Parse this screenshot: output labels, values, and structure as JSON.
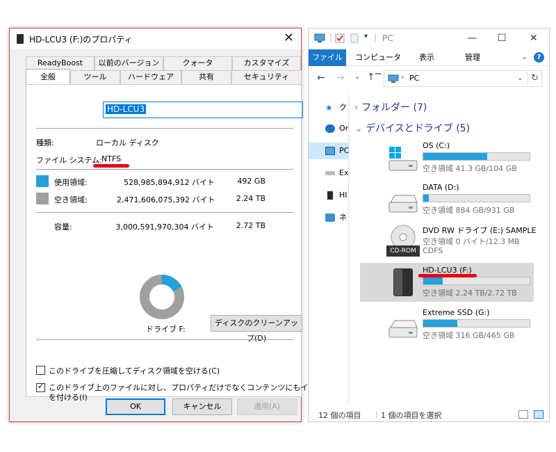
{
  "dialog": {
    "title": "HD-LCU3 (F:)のプロパティ",
    "tabs_row1": [
      "ReadyBoost",
      "以前のバージョン",
      "クォータ",
      "カスタマイズ"
    ],
    "tabs_row2": [
      "全般",
      "ツール",
      "ハードウェア",
      "共有",
      "セキュリティ"
    ],
    "volume_name": "HD-LCU3",
    "type_label": "種類:",
    "type_value": "ローカル ディスク",
    "fs_label": "ファイル システム:",
    "fs_value": "NTFS",
    "used_label": "使用領域:",
    "used_bytes": "528,985,894,912 バイト",
    "used_size": "492 GB",
    "free_label": "空き領域:",
    "free_bytes": "2,471,606,075,392 バイト",
    "free_size": "2.24 TB",
    "capacity_label": "容量:",
    "capacity_bytes": "3,000,591,970,304 バイト",
    "capacity_size": "2.72 TB",
    "drive_label": "ドライブ F:",
    "cleanup_button": "ディスクのクリーンアップ(D)",
    "compress_option": "このドライブを圧縮してディスク領域を空ける(C)",
    "compress_checked": false,
    "index_option_line1": "このドライブ上のファイルに対し、プロパティだけでなくコンテンツにもインデックス",
    "index_option_line2": "を付ける(I)",
    "index_checked": true,
    "ok": "OK",
    "cancel": "キャンセル",
    "apply": "適用(A)",
    "used_fraction": 0.176,
    "colors": {
      "used": "#26a0da",
      "free": "#a0a0a0",
      "accent": "#0078d7",
      "marker": "#e8000e"
    }
  },
  "explorer": {
    "title": "PC",
    "ribbon_tabs": [
      "ファイル",
      "コンピューター",
      "表示",
      "管理"
    ],
    "address": "PC",
    "nav_items": [
      "ク",
      "Or",
      "PC",
      "Ex",
      "HI",
      "ネ"
    ],
    "folders_header": "フォルダー (7)",
    "drives_header": "デバイスとドライブ (5)",
    "drives": [
      {
        "name": "OS (C:)",
        "info": "空き領域 41.3 GB/104 GB",
        "used_fraction": 0.6,
        "icon": "windows-drive-icon"
      },
      {
        "name": "DATA (D:)",
        "info": "空き領域 884 GB/931 GB",
        "used_fraction": 0.05,
        "icon": "hdd-icon"
      },
      {
        "name": "DVD RW ドライブ (E:) SAMPLE",
        "info1": "空き領域 0 バイト/12.3 MB",
        "info2": "CDFS",
        "icon_label": "CD-ROM",
        "icon": "cd-rom-icon"
      },
      {
        "name": "HD-LCU3 (F:)",
        "info": "空き領域 2.24 TB/2.72 TB",
        "used_fraction": 0.18,
        "icon": "external-hdd-icon",
        "selected": true
      },
      {
        "name": "Extreme SSD (G:)",
        "info": "空き領域 316 GB/465 GB",
        "used_fraction": 0.32,
        "icon": "hdd-icon"
      }
    ],
    "status_count": "12 個の項目",
    "status_selected": "1 個の項目を選択"
  }
}
